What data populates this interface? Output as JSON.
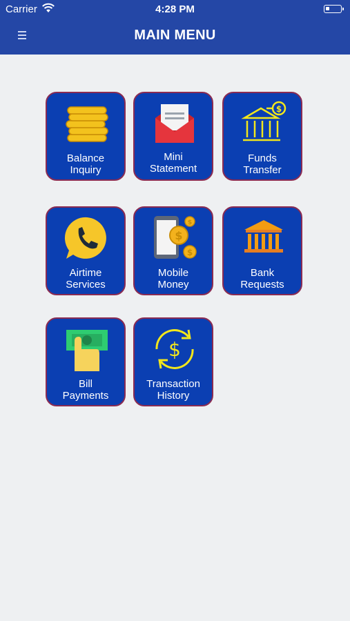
{
  "status_bar": {
    "carrier": "Carrier",
    "time": "4:28 PM"
  },
  "header": {
    "title": "MAIN MENU"
  },
  "menu": [
    {
      "line1": "Balance",
      "line2": "Inquiry",
      "icon": "coins-icon"
    },
    {
      "line1": "Mini",
      "line2": "Statement",
      "icon": "envelope-icon"
    },
    {
      "line1": "Funds",
      "line2": "Transfer",
      "icon": "bank-transfer-icon"
    },
    {
      "line1": "Airtime",
      "line2": "Services",
      "icon": "phone-bubble-icon"
    },
    {
      "line1": "Mobile",
      "line2": "Money",
      "icon": "mobile-money-icon"
    },
    {
      "line1": "Bank",
      "line2": "Requests",
      "icon": "bank-icon"
    },
    {
      "line1": "Bill",
      "line2": "Payments",
      "icon": "cash-hand-icon"
    },
    {
      "line1": "Transaction",
      "line2": "History",
      "icon": "dollar-cycle-icon"
    }
  ],
  "colors": {
    "header": "#2447a6",
    "tile": "#0b3fb2",
    "tile_border": "#8a2b52",
    "background": "#eef0f2"
  }
}
